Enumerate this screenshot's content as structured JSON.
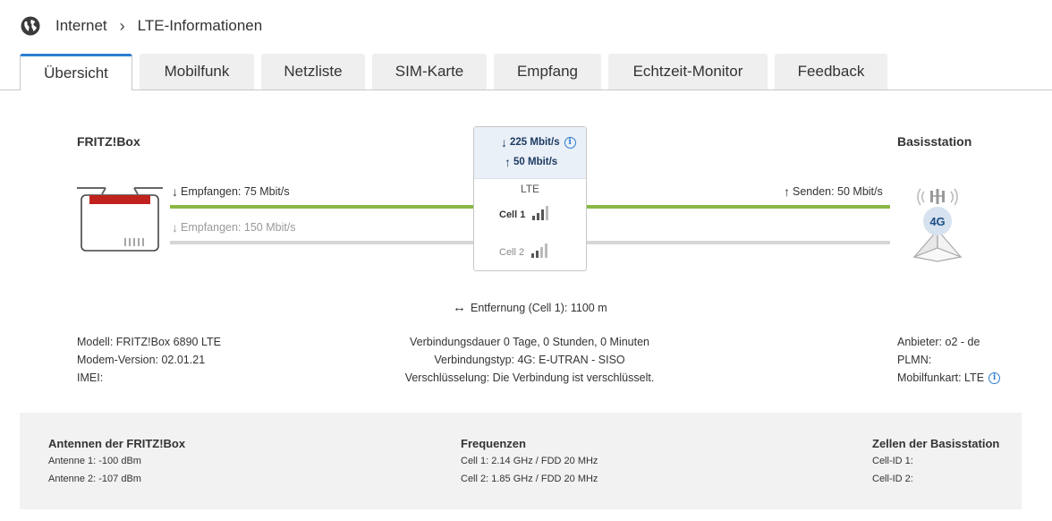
{
  "breadcrumb": {
    "root": "Internet",
    "current": "LTE-Informationen"
  },
  "tabs": [
    {
      "label": "Übersicht",
      "active": true
    },
    {
      "label": "Mobilfunk"
    },
    {
      "label": "Netzliste"
    },
    {
      "label": "SIM-Karte"
    },
    {
      "label": "Empfang"
    },
    {
      "label": "Echtzeit-Monitor"
    },
    {
      "label": "Feedback"
    }
  ],
  "overview": {
    "fritzbox_title": "FRITZ!Box",
    "basestation_title": "Basisstation",
    "rx_primary": "Empfangen: 75 Mbit/s",
    "rx_secondary": "Empfangen: 150 Mbit/s",
    "tx": "Senden: 50 Mbit/s",
    "down_rate": "225 Mbit/s",
    "up_rate": "50 Mbit/s",
    "tech": "LTE",
    "cell1": "Cell 1",
    "cell2": "Cell 2",
    "cell1_signal_bars": 3,
    "cell2_signal_bars": 2,
    "distance": "Entfernung (Cell 1): 1100 m",
    "network_badge": "4G"
  },
  "details_left": {
    "model": "Modell: FRITZ!Box 6890 LTE",
    "modem_version": "Modem-Version: 02.01.21",
    "imei": "IMEI:"
  },
  "details_center": {
    "duration": "Verbindungsdauer 0 Tage, 0 Stunden, 0 Minuten",
    "type": "Verbindungstyp: 4G: E-UTRAN - SISO",
    "encryption": "Verschlüsselung: Die Verbindung ist verschlüsselt."
  },
  "details_right": {
    "provider": "Anbieter: o2 - de",
    "plmn": "PLMN:",
    "mode": "Mobilfunkart: LTE"
  },
  "footer": {
    "antennas": {
      "title": "Antennen der FRITZ!Box",
      "a1": "Antenne 1: -100 dBm",
      "a2": "Antenne 2: -107 dBm"
    },
    "frequencies": {
      "title": "Frequenzen",
      "c1": "Cell 1: 2.14 GHz / FDD 20 MHz",
      "c2": "Cell 2: 1.85 GHz / FDD 20 MHz"
    },
    "cells": {
      "title": "Zellen der Basisstation",
      "id1": "Cell-ID 1:",
      "id2": "Cell-ID 2:"
    }
  },
  "colors": {
    "accent": "#2d7dd2",
    "active_line": "#8ab844",
    "inactive_line": "#d6d6d6",
    "router_red": "#c0231d"
  }
}
